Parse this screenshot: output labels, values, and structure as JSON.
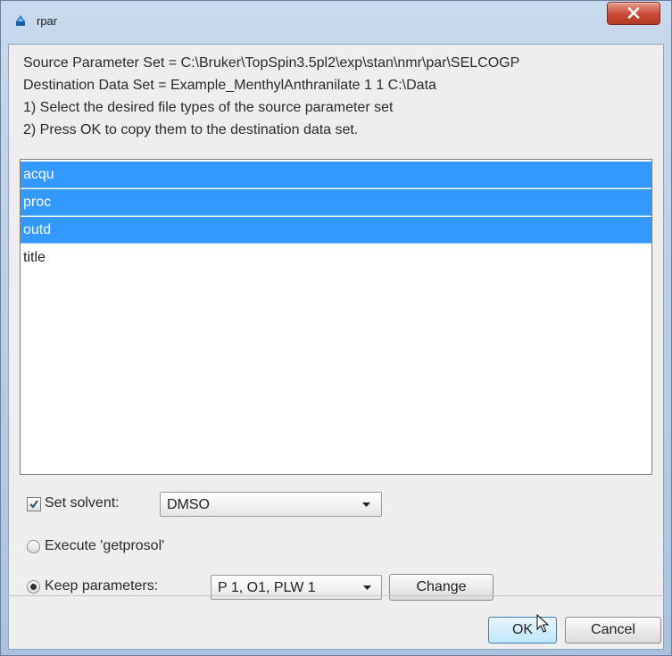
{
  "window": {
    "title": "rpar",
    "close_glyph": "x",
    "accent_color": "#3399ff"
  },
  "info": {
    "line1": "Source Parameter Set = C:\\Bruker\\TopSpin3.5pl2\\exp\\stan\\nmr\\par\\SELCOGP",
    "line2": "Destination Data Set = Example_MenthylAnthranilate  1  1  C:\\Data",
    "line3": "1) Select the desired file types of the source parameter set",
    "line4": "2) Press OK to copy them to the destination data set."
  },
  "file_types": [
    {
      "label": "acqu",
      "selected": true
    },
    {
      "label": "proc",
      "selected": true
    },
    {
      "label": "outd",
      "selected": true
    },
    {
      "label": "title",
      "selected": false
    }
  ],
  "options": {
    "set_solvent": {
      "label": "Set solvent:",
      "checked": true,
      "value": "DMSO"
    },
    "execute": {
      "label": "Execute 'getprosol'",
      "selected": false
    },
    "keep_params": {
      "label": "Keep parameters:",
      "selected": true,
      "value": "P 1, O1, PLW 1",
      "change_label": "Change"
    }
  },
  "buttons": {
    "ok": "OK",
    "cancel": "Cancel"
  },
  "icons": {
    "app": "topspin-app-icon",
    "close": "close-icon",
    "dropdown": "chevron-down-icon",
    "check": "check-icon",
    "cursor": "mouse-pointer-icon"
  }
}
